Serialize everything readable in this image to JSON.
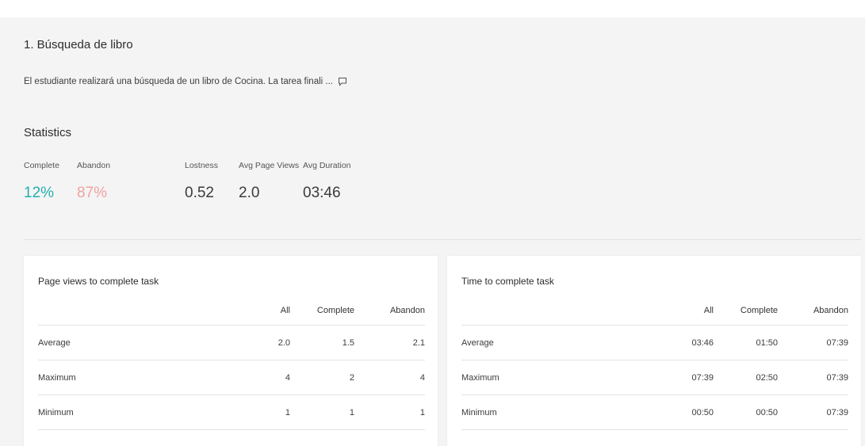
{
  "task": {
    "title": "1. Búsqueda de libro",
    "description": "El estudiante realizará una búsqueda de un libro de Cocina. La tarea finali ..."
  },
  "statistics": {
    "heading": "Statistics",
    "complete": {
      "label": "Complete",
      "value": "12%"
    },
    "abandon": {
      "label": "Abandon",
      "value": "87%"
    },
    "lostness": {
      "label": "Lostness",
      "value": "0.52"
    },
    "avg_page_views": {
      "label": "Avg Page Views",
      "value": "2.0"
    },
    "avg_duration": {
      "label": "Avg Duration",
      "value": "03:46"
    }
  },
  "colors": {
    "complete": "#23b0b0",
    "abandon": "#f0a2a2",
    "background": "#f4f4f4",
    "card": "#ffffff"
  },
  "icons": {
    "comment": "comment-icon"
  },
  "page_views_card": {
    "title": "Page views to complete task",
    "columns": [
      "",
      "All",
      "Complete",
      "Abandon"
    ],
    "rows": [
      {
        "label": "Average",
        "all": "2.0",
        "complete": "1.5",
        "abandon": "2.1"
      },
      {
        "label": "Maximum",
        "all": "4",
        "complete": "2",
        "abandon": "4"
      },
      {
        "label": "Minimum",
        "all": "1",
        "complete": "1",
        "abandon": "1"
      }
    ]
  },
  "time_card": {
    "title": "Time to complete task",
    "columns": [
      "",
      "All",
      "Complete",
      "Abandon"
    ],
    "rows": [
      {
        "label": "Average",
        "all": "03:46",
        "complete": "01:50",
        "abandon": "07:39"
      },
      {
        "label": "Maximum",
        "all": "07:39",
        "complete": "02:50",
        "abandon": "07:39"
      },
      {
        "label": "Minimum",
        "all": "00:50",
        "complete": "00:50",
        "abandon": "07:39"
      }
    ]
  }
}
